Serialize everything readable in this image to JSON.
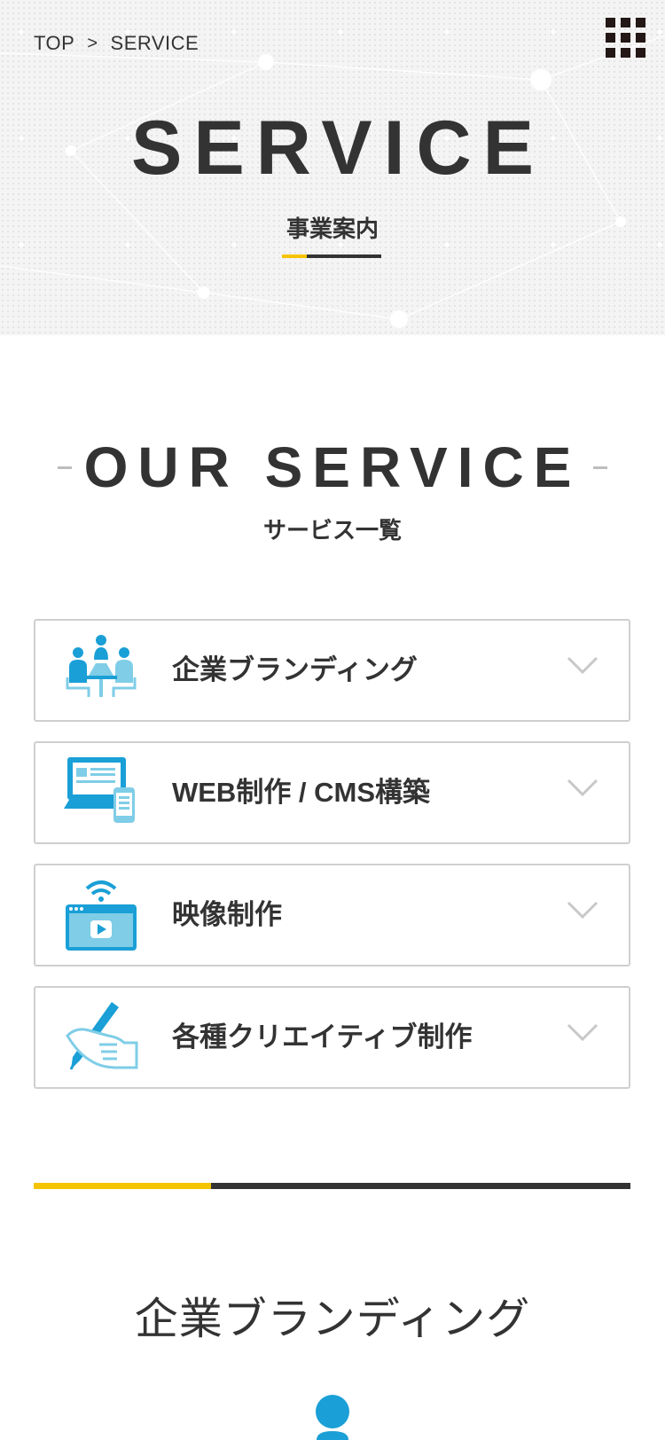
{
  "breadcrumb": {
    "home": "TOP",
    "separator": ">",
    "current": "SERVICE"
  },
  "menu": {
    "icon": "grid-menu-icon"
  },
  "hero": {
    "title": "SERVICE",
    "subtitle": "事業案内"
  },
  "section": {
    "title": "OUR SERVICE",
    "subtitle": "サービス一覧"
  },
  "services": [
    {
      "label": "企業ブランディング",
      "icon": "meeting-people-icon"
    },
    {
      "label": "WEB制作 / CMS構築",
      "icon": "devices-web-icon"
    },
    {
      "label": "映像制作",
      "icon": "video-player-icon"
    },
    {
      "label": "各種クリエイティブ制作",
      "icon": "hand-pen-icon"
    }
  ],
  "detail": {
    "title": "企業ブランディング",
    "icon": "person-icon"
  },
  "colors": {
    "accent": "#f5c400",
    "text": "#333333",
    "icon_blue": "#1a9fd6",
    "icon_light": "#7fcde7",
    "border": "#cfcfcf"
  }
}
